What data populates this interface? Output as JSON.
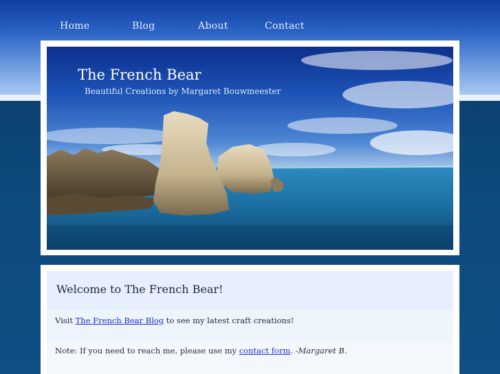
{
  "nav": {
    "items": [
      {
        "label": "Home"
      },
      {
        "label": "Blog"
      },
      {
        "label": "About"
      },
      {
        "label": "Contact"
      }
    ]
  },
  "header": {
    "title": "The French Bear",
    "tagline": "Beautiful Creations by Margaret Bouwmeester"
  },
  "content": {
    "welcome_title": "Welcome to The French Bear!",
    "visit_prefix": "Visit ",
    "visit_link": "The French Bear Blog",
    "visit_suffix": " to see my latest craft creations!",
    "note_prefix": "Note: If you need to reach me, please use my ",
    "note_link": "contact form",
    "note_mid": ".   -",
    "note_signature": "Margaret B."
  },
  "colors": {
    "link": "#1a2fc8",
    "nav_text": "#e6eefc",
    "page_bg": "#0d4a7e"
  }
}
